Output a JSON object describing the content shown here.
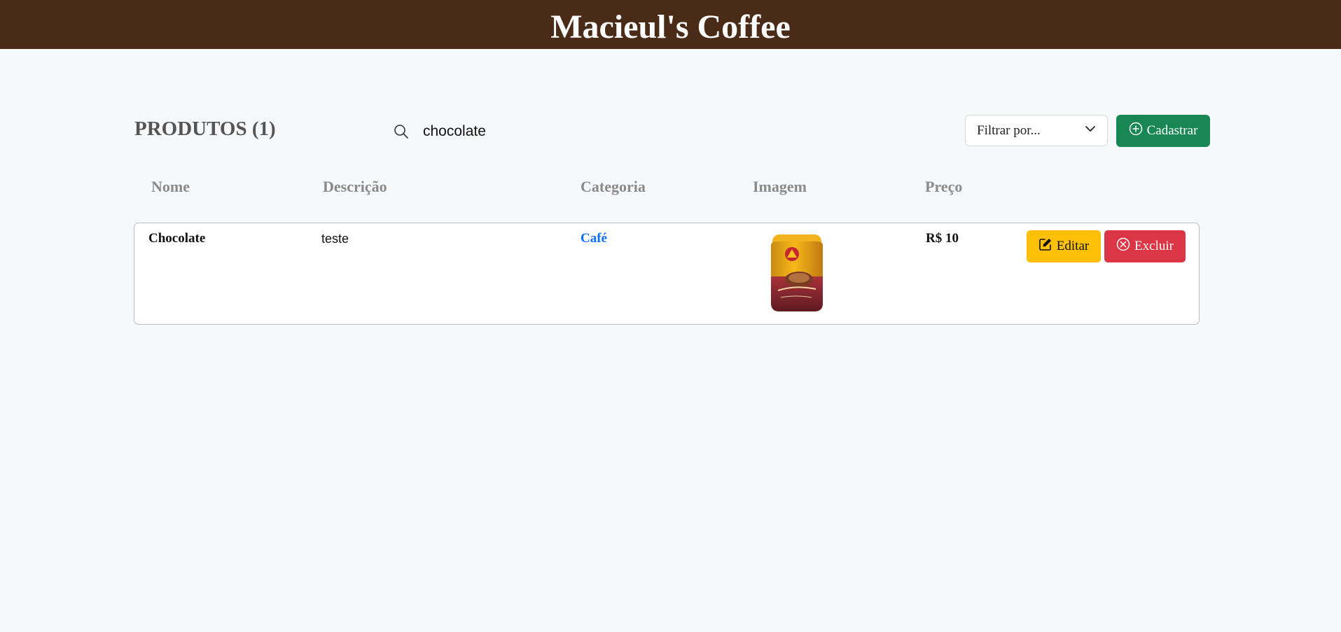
{
  "header": {
    "title": "Macieul's Coffee"
  },
  "main": {
    "heading": "PRODUTOS (1)",
    "search": {
      "value": "chocolate",
      "icon": "search-icon"
    },
    "filter": {
      "selected": "Filtrar por...",
      "icon": "chevron-down-icon"
    },
    "add_button": {
      "label": "Cadastrar",
      "icon": "plus-circle-icon"
    },
    "columns": [
      "Nome",
      "Descrição",
      "Categoria",
      "Imagem",
      "Preço"
    ],
    "rows": [
      {
        "name": "Chocolate",
        "description": "teste",
        "category": "Café",
        "image": "product-jar-image",
        "price": "R$ 10",
        "edit_label": "Editar",
        "delete_label": "Excluir"
      }
    ]
  },
  "colors": {
    "header_bg": "#4a2b18",
    "page_bg": "#f7f8fa",
    "add_button": "#198754",
    "edit_button": "#ffc107",
    "delete_button": "#dc3545",
    "category_link": "#0d6efd"
  }
}
